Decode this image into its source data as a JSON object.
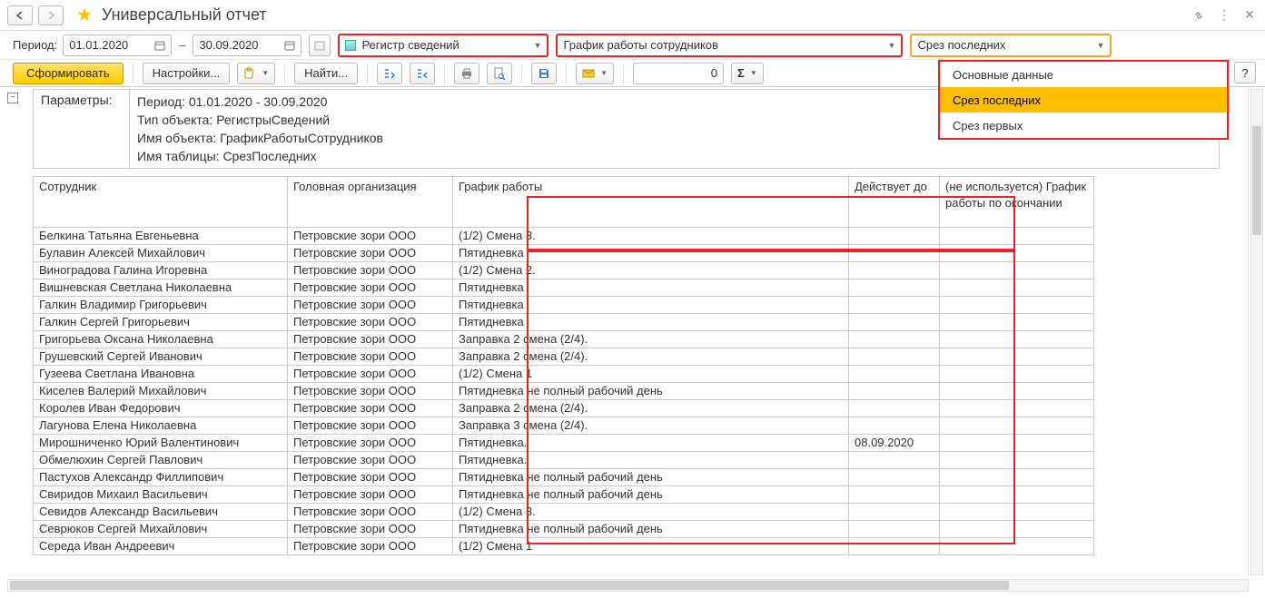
{
  "title": "Универсальный отчет",
  "period_label": "Период:",
  "date_from": "01.01.2020",
  "date_to": "30.09.2020",
  "combo_register": "Регистр сведений",
  "combo_object": "График работы сотрудников",
  "combo_table": "Срез последних",
  "dropdown": {
    "opt0": "Основные данные",
    "opt1": "Срез последних",
    "opt2": "Срез первых"
  },
  "toolbar": {
    "generate": "Сформировать",
    "settings": "Настройки...",
    "find": "Найти...",
    "num_value": "0"
  },
  "help": "?",
  "params": {
    "label": "Параметры:",
    "line0": "Период: 01.01.2020 - 30.09.2020",
    "line1": "Тип объекта: РегистрыСведений",
    "line2": "Имя объекта: ГрафикРаботыСотрудников",
    "line3": "Имя таблицы: СрезПоследних"
  },
  "headers": {
    "employee": "Сотрудник",
    "org": "Головная организация",
    "schedule": "График работы",
    "valid_till": "Действует до",
    "schedule_end": "(не используется) График работы по окончании"
  },
  "rows": [
    {
      "emp": "Белкина Татьяна Евгеньевна",
      "org": "Петровские зори ООО",
      "sch": "(1/2) Смена 3.",
      "till": "",
      "end": ""
    },
    {
      "emp": "Булавин Алексей Михайлович",
      "org": "Петровские зори ООО",
      "sch": "Пятидневка",
      "till": "",
      "end": ""
    },
    {
      "emp": "Виноградова Галина Игоревна",
      "org": "Петровские зори ООО",
      "sch": "(1/2)  Смена 2.",
      "till": "",
      "end": ""
    },
    {
      "emp": "Вишневская Светлана Николаевна",
      "org": "Петровские зори ООО",
      "sch": "Пятидневка",
      "till": "",
      "end": ""
    },
    {
      "emp": "Галкин Владимир Григорьевич",
      "org": "Петровские зори ООО",
      "sch": "Пятидневка",
      "till": "",
      "end": ""
    },
    {
      "emp": "Галкин Сергей Григорьевич",
      "org": "Петровские зори ООО",
      "sch": "Пятидневка",
      "till": "",
      "end": ""
    },
    {
      "emp": "Григорьева Оксана Николаевна",
      "org": "Петровские зори ООО",
      "sch": "Заправка 2 смена (2/4).",
      "till": "",
      "end": ""
    },
    {
      "emp": "Грушевский Сергей Иванович",
      "org": "Петровские зори ООО",
      "sch": "Заправка 2 смена (2/4).",
      "till": "",
      "end": ""
    },
    {
      "emp": "Гузеева Светлана Ивановна",
      "org": "Петровские зори ООО",
      "sch": "(1/2) Смена 1",
      "till": "",
      "end": ""
    },
    {
      "emp": "Киселев Валерий Михайлович",
      "org": "Петровские зори ООО",
      "sch": "Пятидневка не полный рабочий день",
      "till": "",
      "end": ""
    },
    {
      "emp": "Королев Иван Федорович",
      "org": "Петровские зори ООО",
      "sch": "Заправка 2 смена (2/4).",
      "till": "",
      "end": ""
    },
    {
      "emp": "Лагунова Елена Николаевна",
      "org": "Петровские зори ООО",
      "sch": "Заправка 3 смена (2/4).",
      "till": "",
      "end": ""
    },
    {
      "emp": "Мирошниченко Юрий Валентинович",
      "org": "Петровские зори ООО",
      "sch": "Пятидневка.",
      "till": "08.09.2020",
      "end": ""
    },
    {
      "emp": "Обмелюхин Сергей Павлович",
      "org": "Петровские зори ООО",
      "sch": "Пятидневка.",
      "till": "",
      "end": ""
    },
    {
      "emp": "Пастухов Александр Филлипович",
      "org": "Петровские зори ООО",
      "sch": "Пятидневка не полный рабочий день",
      "till": "",
      "end": ""
    },
    {
      "emp": "Свиридов Михаил Васильевич",
      "org": "Петровские зори ООО",
      "sch": "Пятидневка не полный рабочий день",
      "till": "",
      "end": ""
    },
    {
      "emp": "Севидов Александр Васильевич",
      "org": "Петровские зори ООО",
      "sch": "(1/2) Смена 3.",
      "till": "",
      "end": ""
    },
    {
      "emp": "Севрюков Сергей Михайлович",
      "org": "Петровские зори ООО",
      "sch": "Пятидневка не полный рабочий день",
      "till": "",
      "end": ""
    },
    {
      "emp": "Середа Иван Андреевич",
      "org": "Петровские зори ООО",
      "sch": "(1/2) Смена 1",
      "till": "",
      "end": ""
    }
  ]
}
